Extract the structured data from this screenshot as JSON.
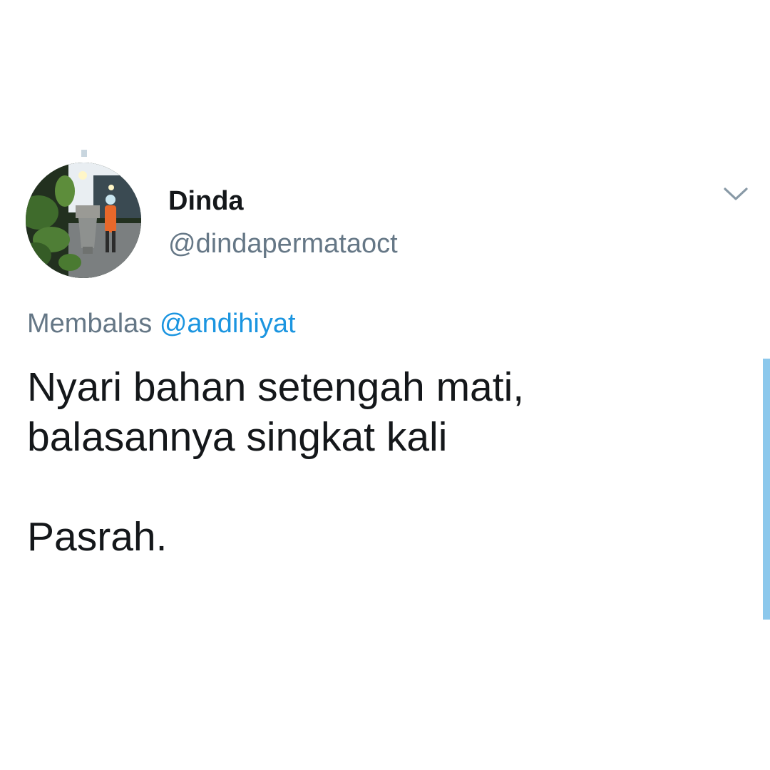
{
  "tweet": {
    "author": {
      "display_name": "Dinda",
      "handle": "@dindapermataoct"
    },
    "reply_context": {
      "prefix": "Membalas",
      "mention": "@andihiyat"
    },
    "text_lines": [
      "Nyari bahan setengah mati,",
      "balasannya singkat kali",
      "",
      "Pasrah."
    ],
    "icons": {
      "menu": "chevron-down-icon"
    },
    "colors": {
      "accent": "#1b95e0",
      "text": "#14171a",
      "secondary": "#657786",
      "scroll_indicator": "#8cc8ec"
    }
  }
}
